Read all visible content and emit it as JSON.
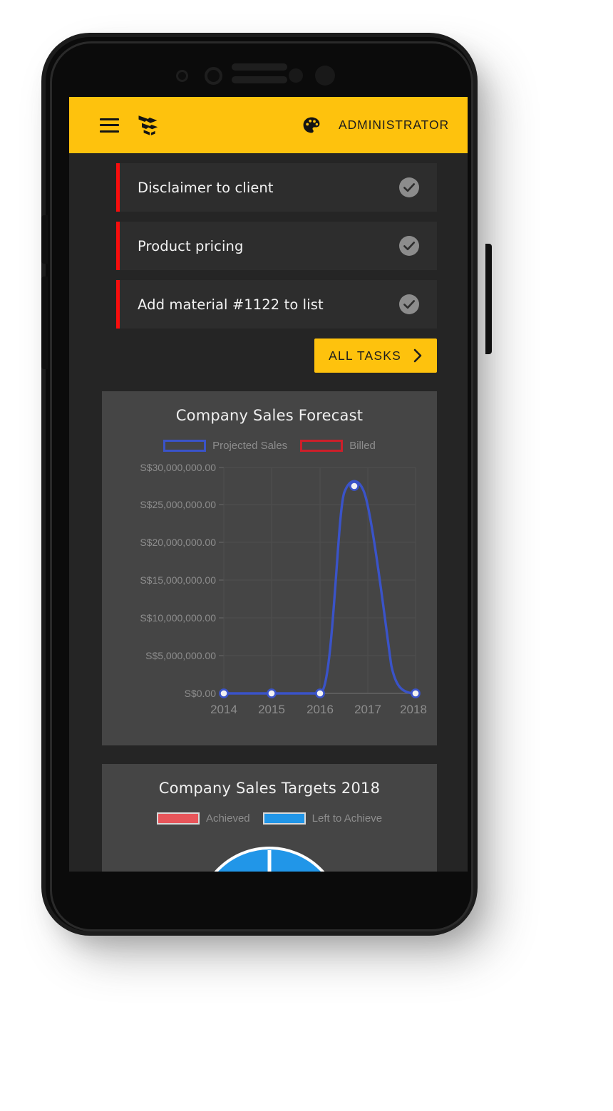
{
  "header": {
    "menu_icon": "hamburger-menu-icon",
    "logo_icon": "open-box-logo-icon",
    "theme_icon": "palette-icon",
    "user_label": "ADMINISTRATOR",
    "background_color": "#fec20d",
    "text_color": "#1d1d1d"
  },
  "tasks": {
    "accent_color": "#f80d0d",
    "items": [
      {
        "label": "Disclaimer to client",
        "status_icon": "check-circle-icon",
        "done": true
      },
      {
        "label": "Product pricing",
        "status_icon": "check-circle-icon",
        "done": true
      },
      {
        "label": "Add material #1122 to list",
        "status_icon": "check-circle-icon",
        "done": true
      }
    ],
    "all_tasks_button": {
      "label": "ALL TASKS",
      "chevron_icon": "chevron-right-icon",
      "background_color": "#fec20d"
    }
  },
  "chart_data": [
    {
      "type": "line",
      "title": "Company Sales Forecast",
      "xlabel": "",
      "ylabel": "",
      "x": [
        "2014",
        "2015",
        "2016",
        "2017",
        "2018"
      ],
      "series": [
        {
          "name": "Projected Sales",
          "color": "#3a53c8",
          "legend_style": "hollow-outline",
          "values": [
            0,
            0,
            0,
            27500000,
            0
          ]
        },
        {
          "name": "Billed",
          "color": "#cc1f2a",
          "legend_style": "hollow-outline",
          "values": [
            0,
            0,
            0,
            0,
            0
          ]
        }
      ],
      "ylim": [
        0,
        30000000
      ],
      "ytick_values": [
        0,
        5000000,
        10000000,
        15000000,
        20000000,
        25000000,
        30000000
      ],
      "ytick_labels": [
        "S$0.00",
        "S$5,000,000.00",
        "S$10,000,000.00",
        "S$15,000,000.00",
        "S$20,000,000.00",
        "S$25,000,000.00",
        "S$30,000,000.00"
      ],
      "grid": true,
      "legend_position": "top",
      "point_marker": "circle",
      "point_fill": "#ffffff",
      "axis_text_color": "#8d8d8d",
      "plot_background": "#414141"
    },
    {
      "type": "pie",
      "title": "Company Sales Targets 2018",
      "labels": [
        "Achieved",
        "Left to Achieve"
      ],
      "colors": [
        "#e8555a",
        "#2196e8"
      ],
      "legend_position": "top",
      "note": "donut chart clipped by bottom of phone screen"
    }
  ]
}
